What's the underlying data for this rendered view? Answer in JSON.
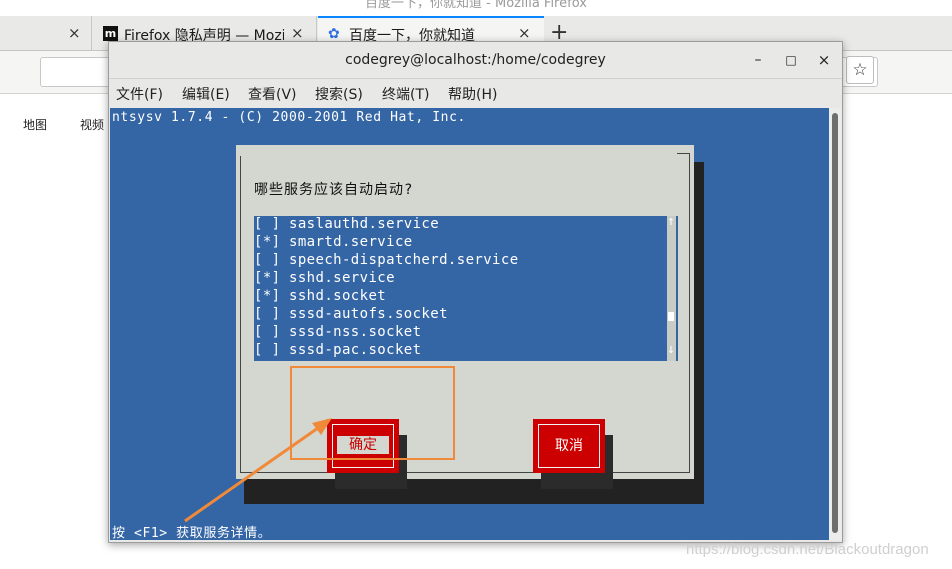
{
  "browser": {
    "window_title": "百度一下，你就知道 - Mozilla Firefox",
    "tabs": [
      {
        "label": ""
      },
      {
        "label": "Firefox 隐私声明 — Mozil",
        "icon": "mozilla-m-icon"
      },
      {
        "label": "百度一下，你就知道",
        "icon": "baidu-paw-icon"
      }
    ],
    "close_glyph": "×",
    "new_tab_glyph": "+",
    "star_glyph": "☆",
    "links": [
      "地图",
      "视频"
    ]
  },
  "terminal": {
    "title": "codegrey@localhost:/home/codegrey",
    "window_buttons": {
      "minimize": "–",
      "maximize": "□",
      "close": "×"
    },
    "menu": [
      "文件(F)",
      "编辑(E)",
      "查看(V)",
      "搜索(S)",
      "终端(T)",
      "帮助(H)"
    ],
    "header_line": "ntsysv 1.7.4 - (C) 2000-2001 Red Hat, Inc.",
    "status_line": "按 <F1> 获取服务详情。",
    "colors": {
      "screen": "#3465a4",
      "dialog": "#d3d7cf",
      "button": "#cc0000",
      "highlight": "#f08a3a"
    }
  },
  "dialog": {
    "prompt": "哪些服务应该自动启动?",
    "services": [
      {
        "mark": "[ ]",
        "name": "saslauthd.service",
        "enabled": false
      },
      {
        "mark": "[*]",
        "name": "smartd.service",
        "enabled": true
      },
      {
        "mark": "[ ]",
        "name": "speech-dispatcherd.service",
        "enabled": false
      },
      {
        "mark": "[*]",
        "name": "sshd.service",
        "enabled": true
      },
      {
        "mark": "[*]",
        "name": "sshd.socket",
        "enabled": true
      },
      {
        "mark": "[ ]",
        "name": "sssd-autofs.socket",
        "enabled": false
      },
      {
        "mark": "[ ]",
        "name": "sssd-nss.socket",
        "enabled": false
      },
      {
        "mark": "[ ]",
        "name": "sssd-pac.socket",
        "enabled": false
      }
    ],
    "scroll_up": "↑",
    "scroll_down": "↓",
    "ok_label": "确定",
    "cancel_label": "取消"
  },
  "watermark": "https://blog.csdn.net/Blackoutdragon"
}
